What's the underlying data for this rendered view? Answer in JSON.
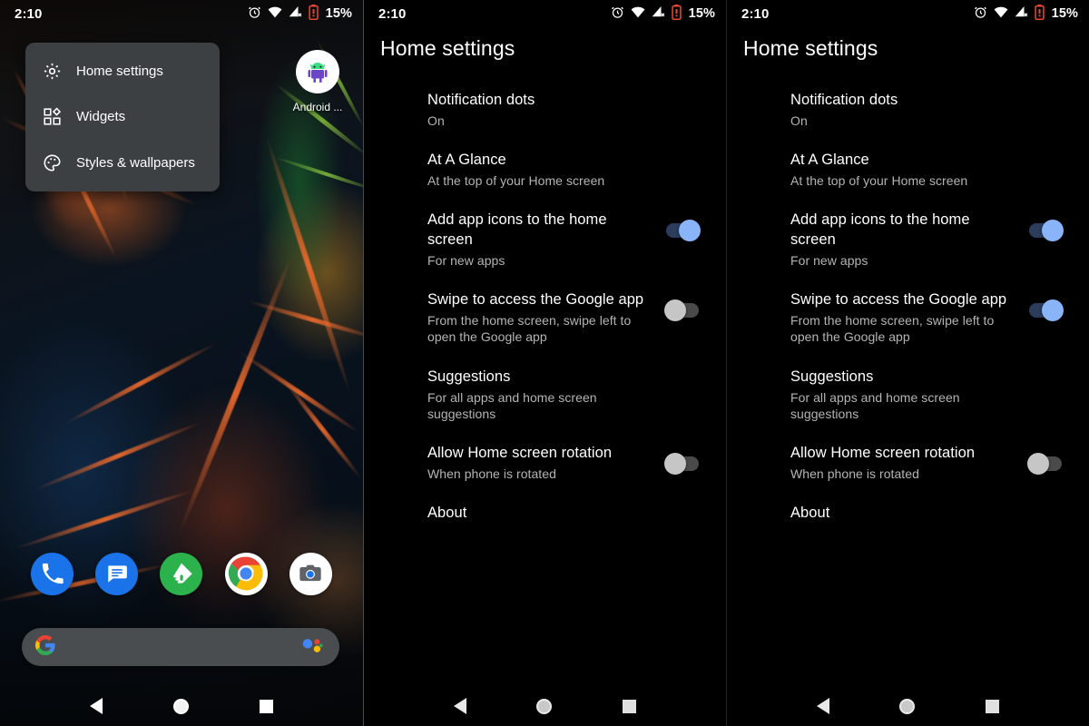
{
  "status_bar": {
    "time": "2:10",
    "battery_percent": "15%",
    "icons": [
      "alarm-icon",
      "wifi-icon",
      "cellular-no-signal-icon",
      "battery-low-icon"
    ]
  },
  "panel1": {
    "name": "home-screen-with-popup-menu",
    "popup_menu": {
      "items": [
        {
          "label": "Home settings",
          "icon": "gear-icon"
        },
        {
          "label": "Widgets",
          "icon": "widgets-icon"
        },
        {
          "label": "Styles & wallpapers",
          "icon": "palette-icon"
        }
      ]
    },
    "home_app": {
      "label": "Android ...",
      "icon": "android-robot-icon"
    },
    "dock": {
      "items": [
        {
          "name": "phone",
          "icon": "phone-icon"
        },
        {
          "name": "messages",
          "icon": "messages-icon"
        },
        {
          "name": "feedly",
          "icon": "feedly-icon"
        },
        {
          "name": "chrome",
          "icon": "chrome-icon"
        },
        {
          "name": "camera",
          "icon": "camera-icon"
        }
      ]
    },
    "search_bar": {
      "left_icon": "google-g-icon",
      "right_icon": "google-assistant-icon"
    }
  },
  "settings": {
    "title": "Home settings",
    "rows": [
      {
        "title": "Notification dots",
        "subtitle": "On",
        "toggle": null
      },
      {
        "title": "At A Glance",
        "subtitle": "At the top of your Home screen",
        "toggle": null
      },
      {
        "title": "Add app icons to the home screen",
        "subtitle": "For new apps",
        "toggle": "on"
      },
      {
        "title": "Swipe to access the Google app",
        "subtitle": "From the home screen, swipe left to open the Google app",
        "toggle": "off"
      },
      {
        "title": "Suggestions",
        "subtitle": "For all apps and home screen suggestions",
        "toggle": null
      },
      {
        "title": "Allow Home screen rotation",
        "subtitle": "When phone is rotated",
        "toggle": "off"
      },
      {
        "title": "About",
        "subtitle": "",
        "toggle": null
      }
    ]
  },
  "settings_variant": {
    "title": "Home settings",
    "rows": [
      {
        "title": "Notification dots",
        "subtitle": "On",
        "toggle": null
      },
      {
        "title": "At A Glance",
        "subtitle": "At the top of your Home screen",
        "toggle": null
      },
      {
        "title": "Add app icons to the home screen",
        "subtitle": "For new apps",
        "toggle": "on"
      },
      {
        "title": "Swipe to access the Google app",
        "subtitle": "From the home screen, swipe left to open the Google app",
        "toggle": "on"
      },
      {
        "title": "Suggestions",
        "subtitle": "For all apps and home screen suggestions",
        "toggle": null
      },
      {
        "title": "Allow Home screen rotation",
        "subtitle": "When phone is rotated",
        "toggle": "off"
      },
      {
        "title": "About",
        "subtitle": "",
        "toggle": null
      }
    ]
  },
  "nav_bar": {
    "back": "back-icon",
    "home": "home-icon",
    "recents": "recents-icon"
  },
  "colors": {
    "accent_on_thumb": "#8ab4f8",
    "accent_on_track": "#2b3c5c",
    "off_thumb": "#c6c6c6",
    "off_track": "#4a4a4a",
    "background": "#000000",
    "popup_bg": "#3c4043",
    "secondary_text": "#b4b4b4",
    "battery_warning": "#e8462e"
  }
}
